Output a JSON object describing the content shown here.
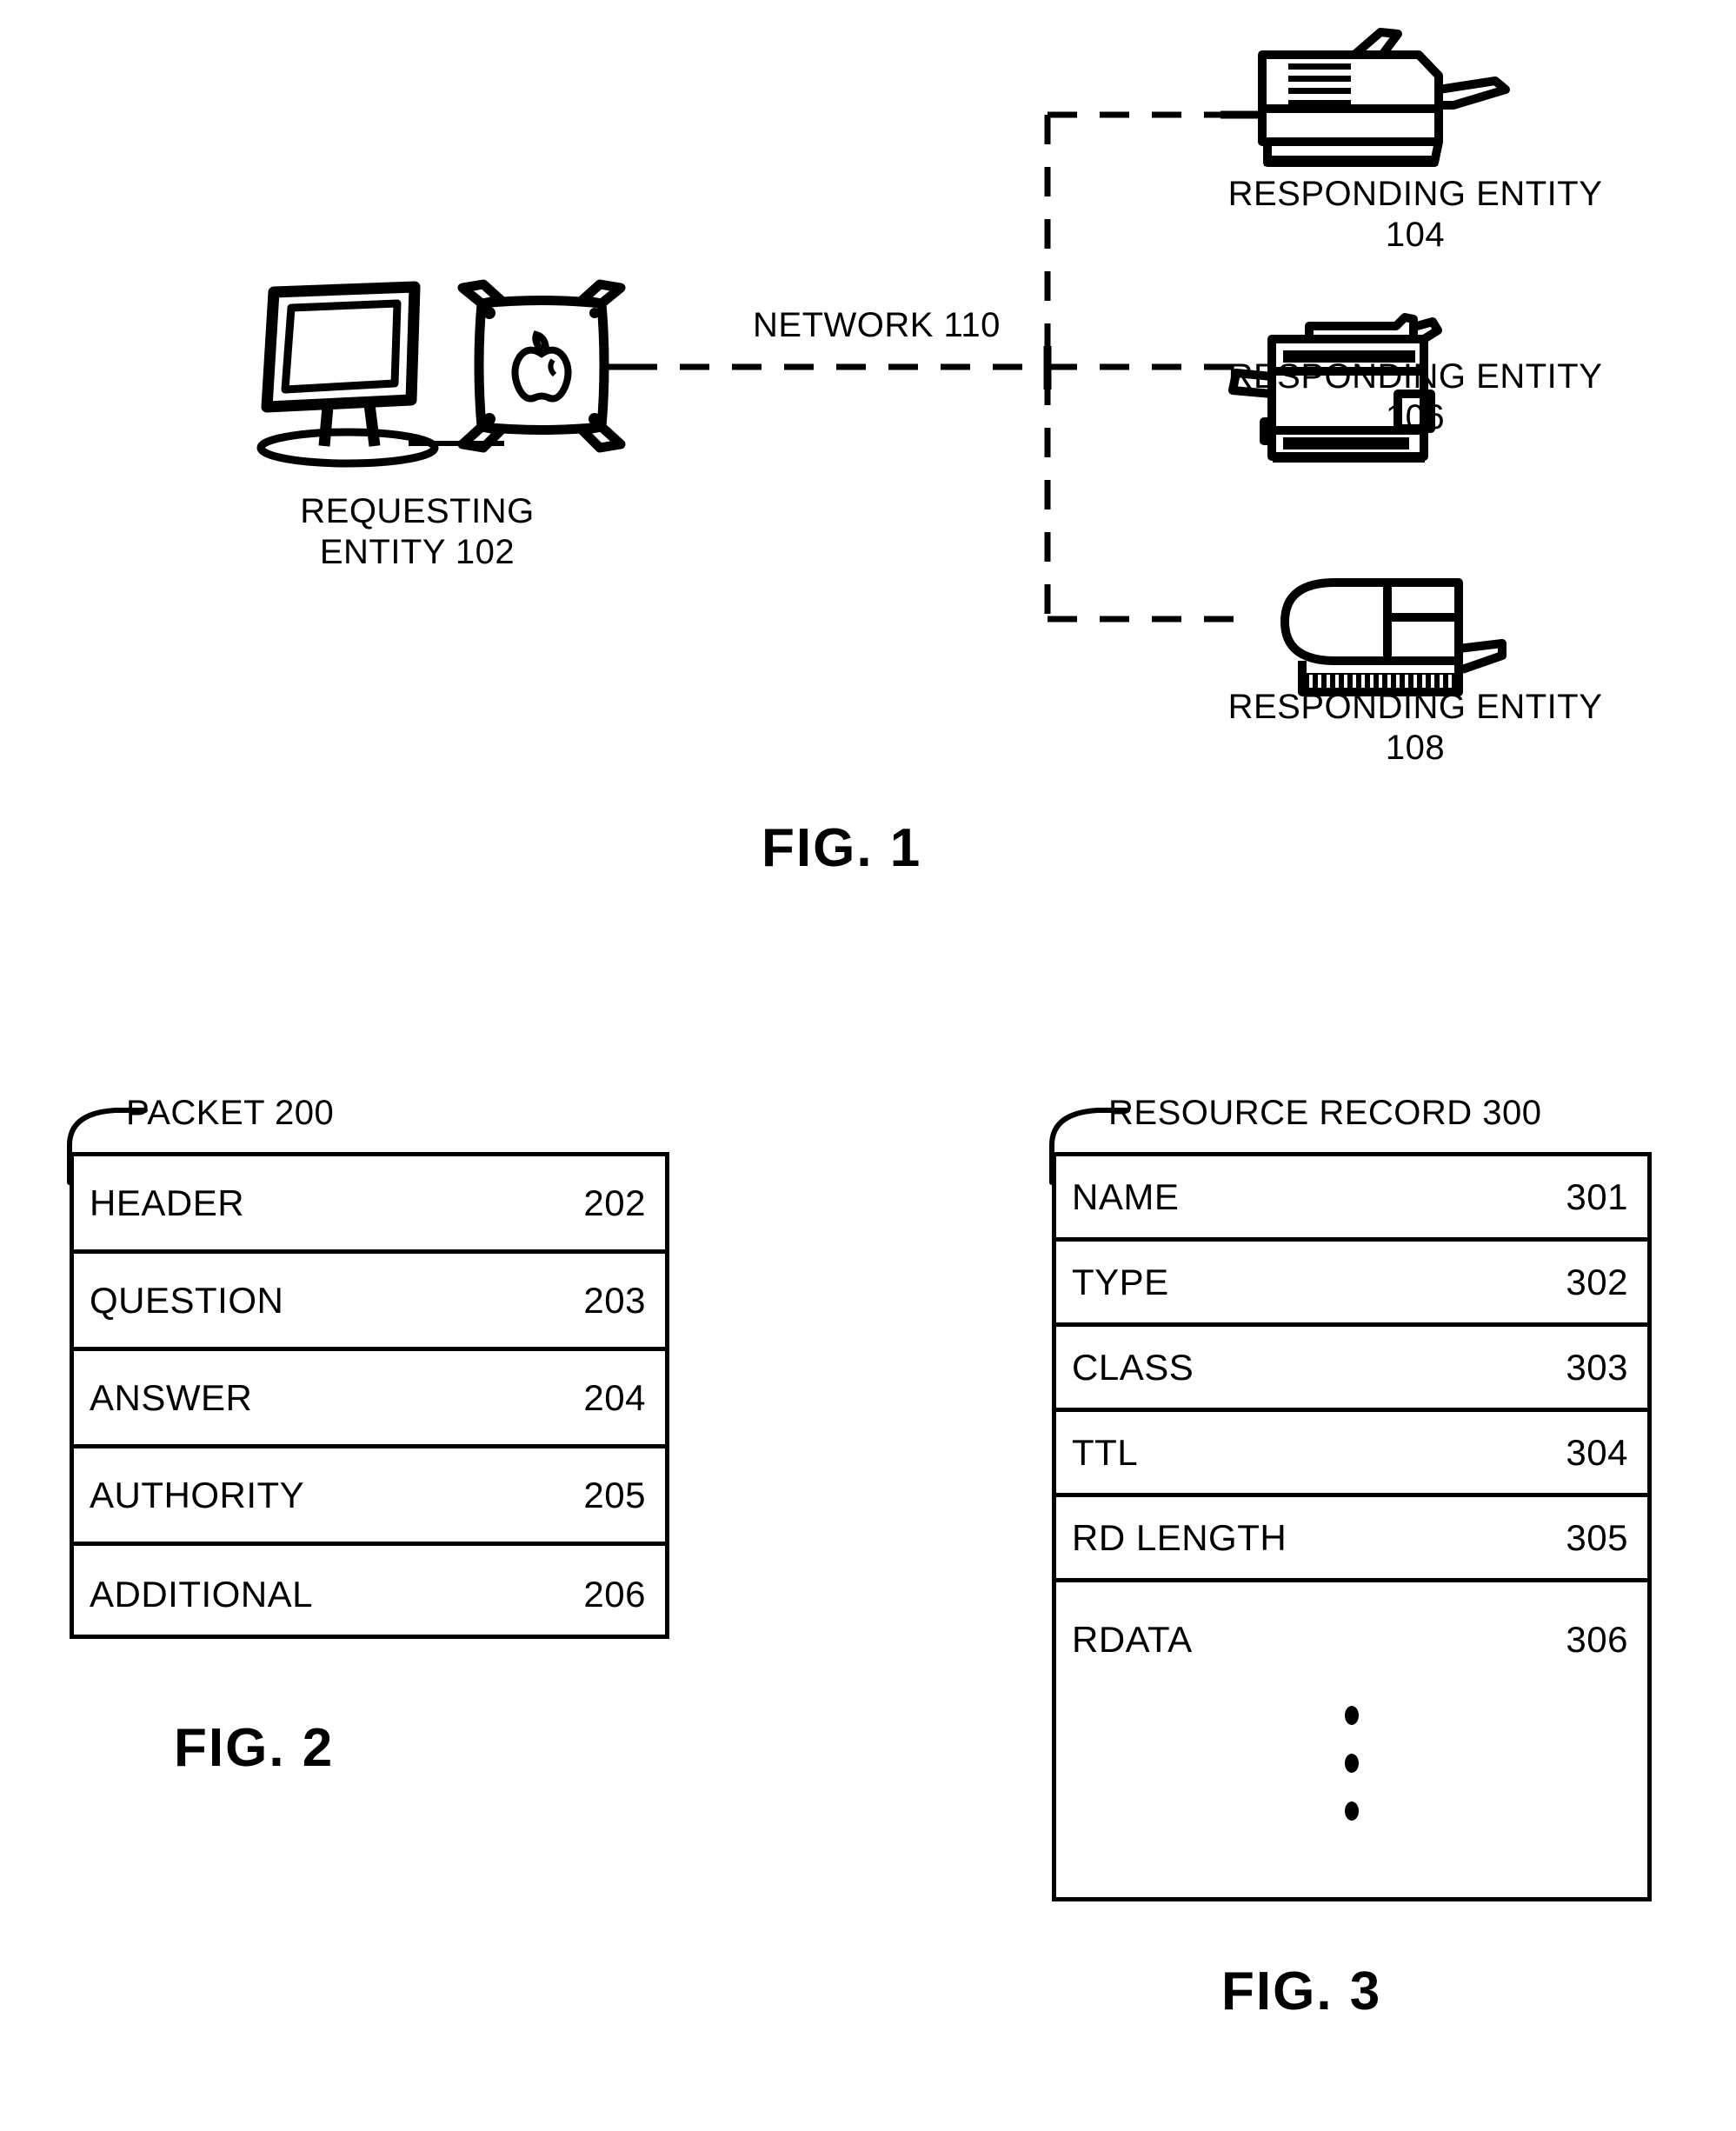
{
  "figure1": {
    "caption": "FIG. 1",
    "network_label": "NETWORK  110",
    "requesting_entity": {
      "line1": "REQUESTING",
      "line2": "ENTITY  102",
      "icon_monitor": "computer-monitor-icon",
      "icon_tower": "apple-tower-icon"
    },
    "responding_entities": [
      {
        "line1": "RESPONDING ENTITY",
        "line2": "104",
        "icon": "laser-printer-icon"
      },
      {
        "line1": "RESPONDING ENTITY",
        "line2": "106",
        "icon": "copier-printer-icon"
      },
      {
        "line1": "RESPONDING ENTITY",
        "line2": "108",
        "icon": "scanner-device-icon"
      }
    ]
  },
  "figure2": {
    "caption": "FIG. 2",
    "title": "PACKET  200",
    "rows": [
      {
        "name": "HEADER",
        "num": "202"
      },
      {
        "name": "QUESTION",
        "num": "203"
      },
      {
        "name": "ANSWER",
        "num": "204"
      },
      {
        "name": "AUTHORITY",
        "num": "205"
      },
      {
        "name": "ADDITIONAL",
        "num": "206"
      }
    ]
  },
  "figure3": {
    "caption": "FIG. 3",
    "title": "RESOURCE RECORD  300",
    "rows": [
      {
        "name": "NAME",
        "num": "301"
      },
      {
        "name": "TYPE",
        "num": "302"
      },
      {
        "name": "CLASS",
        "num": "303"
      },
      {
        "name": "TTL",
        "num": "304"
      },
      {
        "name": "RD LENGTH",
        "num": "305"
      },
      {
        "name": "RDATA",
        "num": "306"
      }
    ],
    "continuation_marker": "vertical-ellipsis"
  },
  "colors": {
    "ink": "#000000",
    "paper": "#ffffff"
  }
}
